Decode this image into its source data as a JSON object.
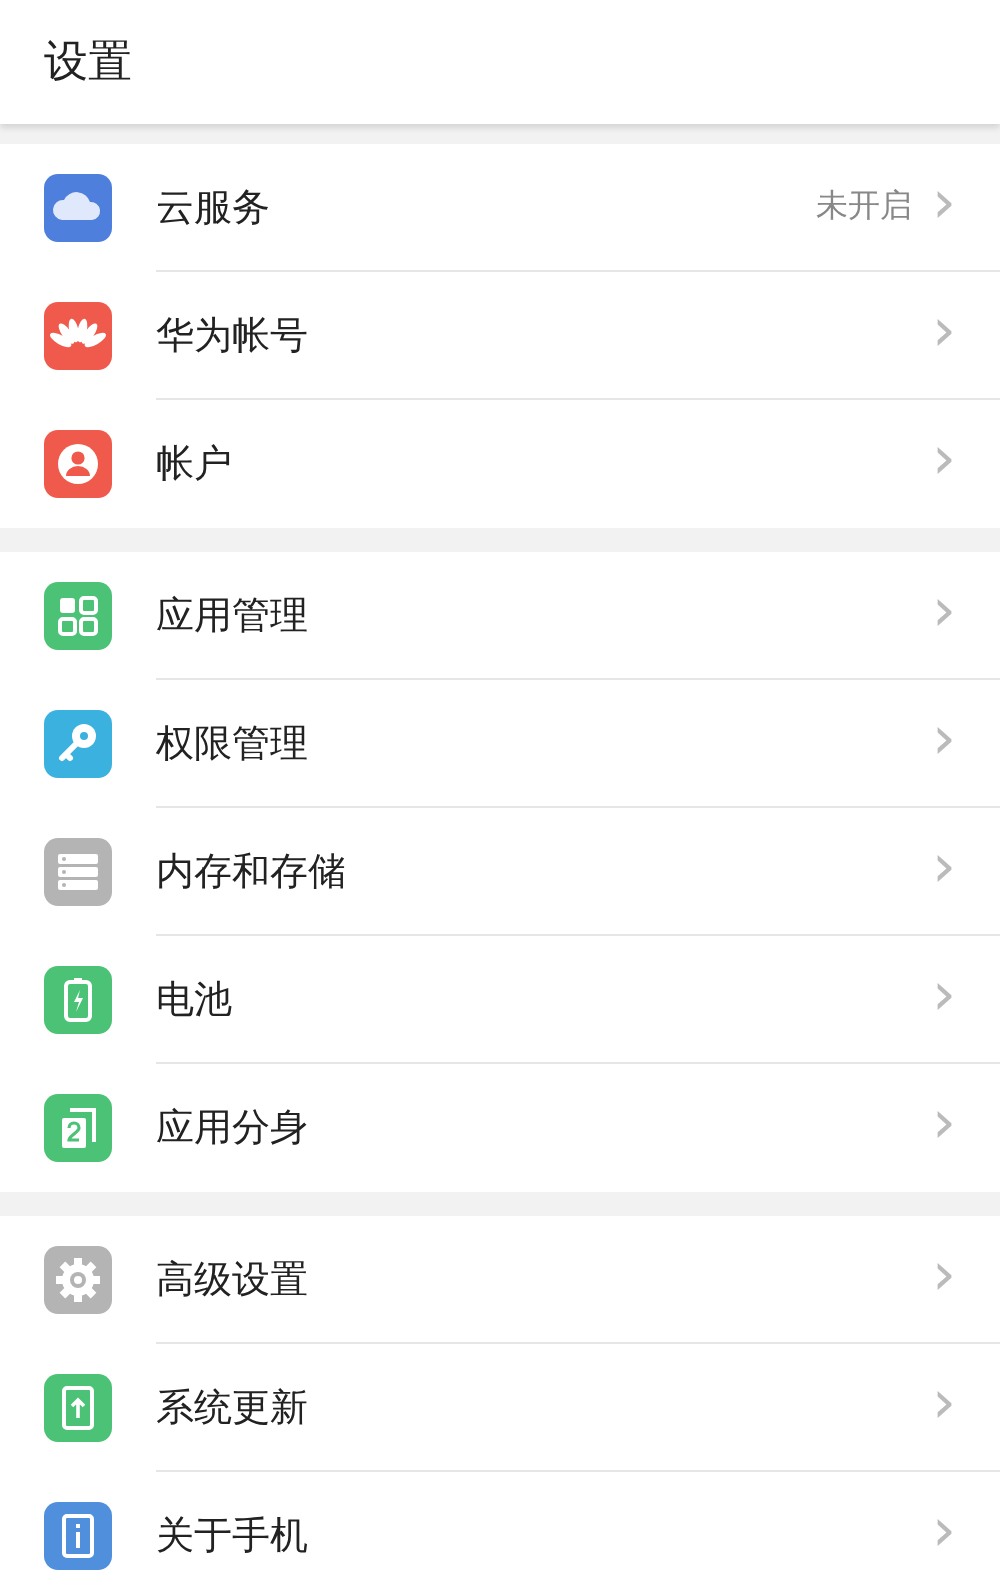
{
  "header": {
    "title": "设置"
  },
  "sections": [
    {
      "items": [
        {
          "kind": "cloud",
          "label": "云服务",
          "status": "未开启",
          "chevron": "›"
        },
        {
          "kind": "petals",
          "label": "华为帐号",
          "chevron": "›"
        },
        {
          "kind": "person",
          "label": "帐户",
          "chevron": "›"
        }
      ]
    },
    {
      "items": [
        {
          "kind": "grid",
          "label": "应用管理",
          "chevron": "›"
        },
        {
          "kind": "key",
          "label": "权限管理",
          "chevron": "›"
        },
        {
          "kind": "storage",
          "label": "内存和存储",
          "chevron": "›"
        },
        {
          "kind": "battery",
          "label": "电池",
          "chevron": "›"
        },
        {
          "kind": "clone",
          "label": "应用分身",
          "chevron": "›"
        }
      ]
    },
    {
      "items": [
        {
          "kind": "gear",
          "label": "高级设置",
          "chevron": "›"
        },
        {
          "kind": "update",
          "label": "系统更新",
          "chevron": "›"
        },
        {
          "kind": "info",
          "label": "关于手机",
          "chevron": "›"
        }
      ]
    }
  ]
}
